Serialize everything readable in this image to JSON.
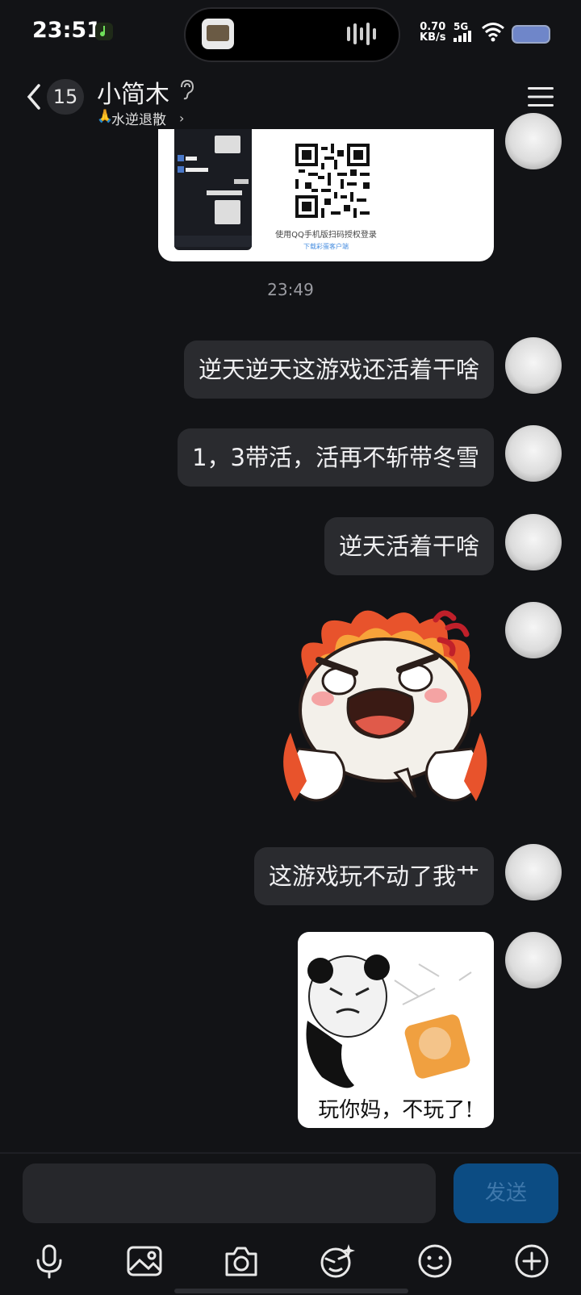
{
  "status_bar": {
    "time": "23:51",
    "net_speed_value": "0.70",
    "net_speed_unit": "KB/s",
    "network": "5G"
  },
  "header": {
    "unread_count": "15",
    "title": "小简木",
    "subtitle": "水逆退散",
    "subtitle_emoji": "🙏"
  },
  "card": {
    "line1": "使用QQ手机版扫码授权登录",
    "line2": "下载彩蛋客户端"
  },
  "time_divider": "23:49",
  "messages": [
    {
      "type": "text",
      "text": "逆天逆天这游戏还活着干啥"
    },
    {
      "type": "text",
      "text": "1，3带活，活再不斩带冬雪"
    },
    {
      "type": "text",
      "text": "逆天活着干啥"
    },
    {
      "type": "sticker",
      "name": "rage-sticker"
    },
    {
      "type": "text",
      "text": "这游戏玩不动了我艹"
    },
    {
      "type": "image",
      "caption": "玩你妈，不玩了!"
    }
  ],
  "input": {
    "placeholder": "",
    "send_label": "发送"
  },
  "toolbar": [
    "microphone-icon",
    "image-icon",
    "camera-icon",
    "sticker-icon",
    "emoji-icon",
    "plus-icon"
  ],
  "colors": {
    "background": "#121316",
    "bubble": "#2a2b2f",
    "send_button": "#0c4c83"
  }
}
